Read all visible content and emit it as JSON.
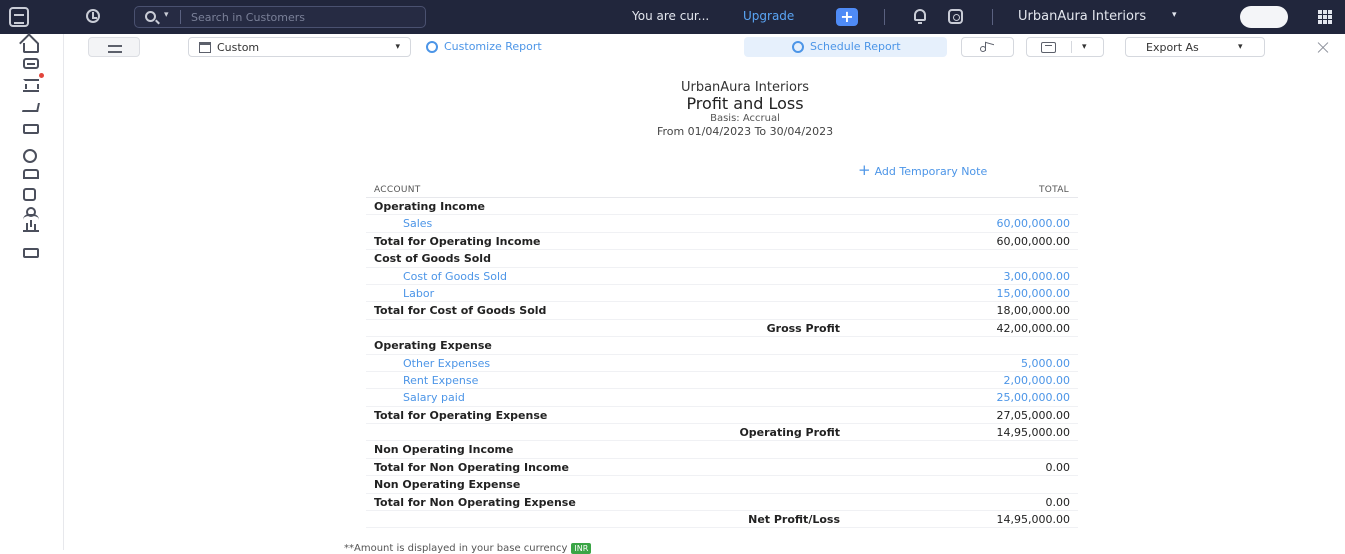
{
  "topbar": {
    "search_placeholder": "Search in Customers",
    "notice": "You are cur...",
    "upgrade": "Upgrade",
    "org_name": "UrbanAura Interiors"
  },
  "toolbar": {
    "period": "Custom",
    "customize": "Customize Report",
    "schedule": "Schedule Report",
    "export": "Export As"
  },
  "report": {
    "org": "UrbanAura Interiors",
    "title": "Profit and Loss",
    "basis": "Basis: Accrual",
    "range": "From 01/04/2023 To 30/04/2023",
    "add_note": "Add Temporary Note",
    "col_account": "ACCOUNT",
    "col_total": "TOTAL",
    "rows": [
      {
        "label": "Operating Income",
        "kind": "section"
      },
      {
        "label": "Sales",
        "kind": "account",
        "value": "60,00,000.00"
      },
      {
        "label": "Total for Operating Income",
        "kind": "total",
        "value": "60,00,000.00"
      },
      {
        "label": "Cost of Goods Sold",
        "kind": "section"
      },
      {
        "label": "Cost of Goods Sold",
        "kind": "account",
        "value": "3,00,000.00"
      },
      {
        "label": "Labor",
        "kind": "account",
        "value": "15,00,000.00"
      },
      {
        "label": "Total for Cost of Goods Sold",
        "kind": "total",
        "value": "18,00,000.00"
      },
      {
        "label": "Gross Profit",
        "kind": "summary",
        "value": "42,00,000.00"
      },
      {
        "label": "Operating Expense",
        "kind": "section"
      },
      {
        "label": "Other Expenses",
        "kind": "account",
        "value": "5,000.00"
      },
      {
        "label": "Rent Expense",
        "kind": "account",
        "value": "2,00,000.00"
      },
      {
        "label": "Salary paid",
        "kind": "account",
        "value": "25,00,000.00"
      },
      {
        "label": "Total for Operating Expense",
        "kind": "total",
        "value": "27,05,000.00"
      },
      {
        "label": "Operating Profit",
        "kind": "summary",
        "value": "14,95,000.00"
      },
      {
        "label": "Non Operating Income",
        "kind": "section"
      },
      {
        "label": "Total for Non Operating Income",
        "kind": "total",
        "value": "0.00"
      },
      {
        "label": "Non Operating Expense",
        "kind": "section"
      },
      {
        "label": "Total for Non Operating Expense",
        "kind": "total",
        "value": "0.00"
      },
      {
        "label": "Net Profit/Loss",
        "kind": "summary",
        "value": "14,95,000.00"
      }
    ],
    "footnote": "**Amount is displayed in your base currency",
    "currency_badge": "INR"
  }
}
